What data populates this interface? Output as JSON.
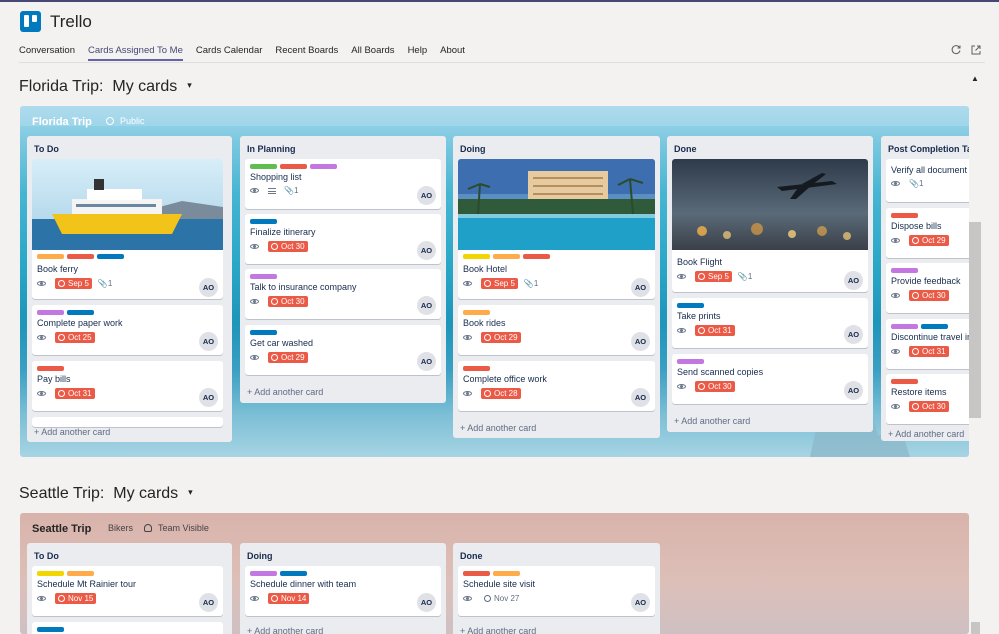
{
  "app": {
    "title": "Trello"
  },
  "nav": [
    "Conversation",
    "Cards Assigned To Me",
    "Cards Calendar",
    "Recent Boards",
    "All Boards",
    "Help",
    "About"
  ],
  "icons": {
    "refresh": "refresh-icon",
    "popout": "popout-icon"
  },
  "sections": [
    {
      "prefix": "Florida Trip:",
      "view": "My cards",
      "board_name": "Florida Trip",
      "visibility": "Public"
    },
    {
      "prefix": "Seattle Trip:",
      "view": "My cards",
      "board_name": "Seattle Trip",
      "team": "Bikers",
      "visibility": "Team Visible"
    }
  ],
  "common": {
    "add_card": "+ Add another card",
    "avatar": "AO",
    "sort_caret": "▾"
  },
  "colors": {
    "green": "#61bd4f",
    "yellow": "#f2d600",
    "orange": "#ffab4a",
    "red": "#eb5a46",
    "purple": "#c377e0",
    "blue": "#0079bf",
    "due": "#eb5a46"
  },
  "florida_lists": [
    {
      "title": "To Do",
      "cards": [
        {
          "labels": [
            "orange",
            "red",
            "blue"
          ],
          "title": "Book ferry",
          "due": "Sep 5",
          "attachments": "1",
          "image": "ferry"
        },
        {
          "labels": [
            "purple",
            "blue"
          ],
          "title": "Complete paper work",
          "due": "Oct 25"
        },
        {
          "labels": [
            "red"
          ],
          "title": "Pay bills",
          "due": "Oct 31"
        }
      ]
    },
    {
      "title": "In Planning",
      "cards": [
        {
          "labels": [
            "green",
            "red",
            "purple"
          ],
          "title": "Shopping list",
          "attachments": "1",
          "description": true
        },
        {
          "labels": [
            "blue"
          ],
          "title": "Finalize itinerary",
          "due": "Oct 30"
        },
        {
          "labels": [
            "purple"
          ],
          "title": "Talk to insurance company",
          "due": "Oct 30"
        },
        {
          "labels": [
            "blue"
          ],
          "title": "Get car washed",
          "due": "Oct 29"
        }
      ]
    },
    {
      "title": "Doing",
      "cards": [
        {
          "labels": [
            "yellow",
            "orange",
            "red"
          ],
          "title": "Book Hotel",
          "due": "Sep 5",
          "attachments": "1",
          "image": "hotel"
        },
        {
          "labels": [
            "orange"
          ],
          "title": "Book rides",
          "due": "Oct 29"
        },
        {
          "labels": [
            "red"
          ],
          "title": "Complete office work",
          "due": "Oct 28"
        }
      ]
    },
    {
      "title": "Done",
      "cards": [
        {
          "labels": [],
          "title": "Book Flight",
          "due": "Sep 5",
          "attachments": "1",
          "image": "plane"
        },
        {
          "labels": [
            "blue"
          ],
          "title": "Take prints",
          "due": "Oct 31"
        },
        {
          "labels": [
            "purple"
          ],
          "title": "Send scanned copies",
          "due": "Oct 30"
        }
      ]
    },
    {
      "title": "Post Completion Ta",
      "cards": [
        {
          "labels": [],
          "title": "Verify all document",
          "attachments": "1"
        },
        {
          "labels": [
            "red"
          ],
          "title": "Dispose bills",
          "due": "Oct 29"
        },
        {
          "labels": [
            "purple"
          ],
          "title": "Provide feedback",
          "due": "Oct 30"
        },
        {
          "labels": [
            "purple",
            "blue"
          ],
          "title": "Discontinue travel in",
          "due": "Oct 31"
        },
        {
          "labels": [
            "red"
          ],
          "title": "Restore items",
          "due": "Oct 30"
        }
      ]
    }
  ],
  "seattle_lists": [
    {
      "title": "To Do",
      "cards": [
        {
          "labels": [
            "yellow",
            "orange"
          ],
          "title": "Schedule Mt Rainier tour",
          "due": "Nov 15"
        },
        {
          "labels": [
            "blue"
          ]
        }
      ]
    },
    {
      "title": "Doing",
      "cards": [
        {
          "labels": [
            "purple",
            "blue"
          ],
          "title": "Schedule dinner with team",
          "due": "Nov 14"
        }
      ]
    },
    {
      "title": "Done",
      "cards": [
        {
          "labels": [
            "red",
            "orange"
          ],
          "title": "Schedule site visit",
          "due": "Nov 27",
          "due_plain": true
        }
      ]
    }
  ]
}
